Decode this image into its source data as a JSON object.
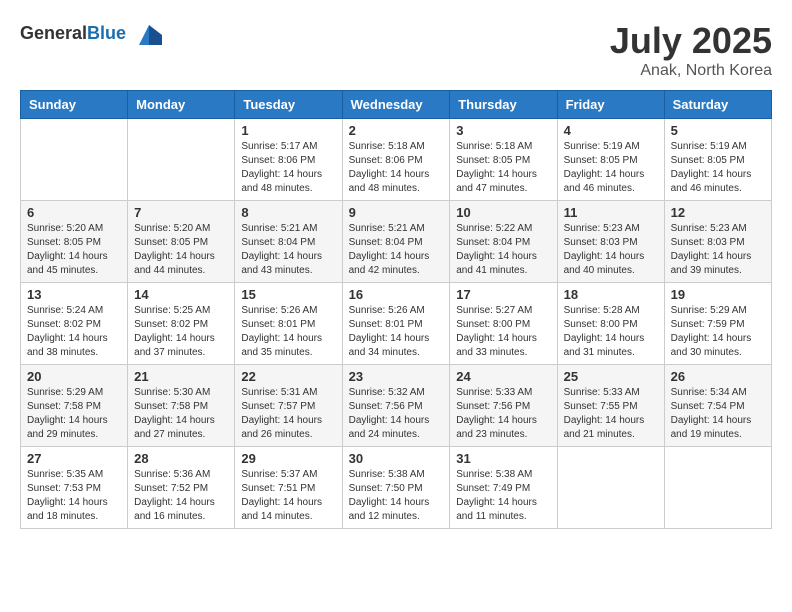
{
  "header": {
    "logo_general": "General",
    "logo_blue": "Blue",
    "month_year": "July 2025",
    "location": "Anak, North Korea"
  },
  "weekdays": [
    "Sunday",
    "Monday",
    "Tuesday",
    "Wednesday",
    "Thursday",
    "Friday",
    "Saturday"
  ],
  "weeks": [
    [
      {
        "day": "",
        "sunrise": "",
        "sunset": "",
        "daylight": ""
      },
      {
        "day": "",
        "sunrise": "",
        "sunset": "",
        "daylight": ""
      },
      {
        "day": "1",
        "sunrise": "Sunrise: 5:17 AM",
        "sunset": "Sunset: 8:06 PM",
        "daylight": "Daylight: 14 hours and 48 minutes."
      },
      {
        "day": "2",
        "sunrise": "Sunrise: 5:18 AM",
        "sunset": "Sunset: 8:06 PM",
        "daylight": "Daylight: 14 hours and 48 minutes."
      },
      {
        "day": "3",
        "sunrise": "Sunrise: 5:18 AM",
        "sunset": "Sunset: 8:05 PM",
        "daylight": "Daylight: 14 hours and 47 minutes."
      },
      {
        "day": "4",
        "sunrise": "Sunrise: 5:19 AM",
        "sunset": "Sunset: 8:05 PM",
        "daylight": "Daylight: 14 hours and 46 minutes."
      },
      {
        "day": "5",
        "sunrise": "Sunrise: 5:19 AM",
        "sunset": "Sunset: 8:05 PM",
        "daylight": "Daylight: 14 hours and 46 minutes."
      }
    ],
    [
      {
        "day": "6",
        "sunrise": "Sunrise: 5:20 AM",
        "sunset": "Sunset: 8:05 PM",
        "daylight": "Daylight: 14 hours and 45 minutes."
      },
      {
        "day": "7",
        "sunrise": "Sunrise: 5:20 AM",
        "sunset": "Sunset: 8:05 PM",
        "daylight": "Daylight: 14 hours and 44 minutes."
      },
      {
        "day": "8",
        "sunrise": "Sunrise: 5:21 AM",
        "sunset": "Sunset: 8:04 PM",
        "daylight": "Daylight: 14 hours and 43 minutes."
      },
      {
        "day": "9",
        "sunrise": "Sunrise: 5:21 AM",
        "sunset": "Sunset: 8:04 PM",
        "daylight": "Daylight: 14 hours and 42 minutes."
      },
      {
        "day": "10",
        "sunrise": "Sunrise: 5:22 AM",
        "sunset": "Sunset: 8:04 PM",
        "daylight": "Daylight: 14 hours and 41 minutes."
      },
      {
        "day": "11",
        "sunrise": "Sunrise: 5:23 AM",
        "sunset": "Sunset: 8:03 PM",
        "daylight": "Daylight: 14 hours and 40 minutes."
      },
      {
        "day": "12",
        "sunrise": "Sunrise: 5:23 AM",
        "sunset": "Sunset: 8:03 PM",
        "daylight": "Daylight: 14 hours and 39 minutes."
      }
    ],
    [
      {
        "day": "13",
        "sunrise": "Sunrise: 5:24 AM",
        "sunset": "Sunset: 8:02 PM",
        "daylight": "Daylight: 14 hours and 38 minutes."
      },
      {
        "day": "14",
        "sunrise": "Sunrise: 5:25 AM",
        "sunset": "Sunset: 8:02 PM",
        "daylight": "Daylight: 14 hours and 37 minutes."
      },
      {
        "day": "15",
        "sunrise": "Sunrise: 5:26 AM",
        "sunset": "Sunset: 8:01 PM",
        "daylight": "Daylight: 14 hours and 35 minutes."
      },
      {
        "day": "16",
        "sunrise": "Sunrise: 5:26 AM",
        "sunset": "Sunset: 8:01 PM",
        "daylight": "Daylight: 14 hours and 34 minutes."
      },
      {
        "day": "17",
        "sunrise": "Sunrise: 5:27 AM",
        "sunset": "Sunset: 8:00 PM",
        "daylight": "Daylight: 14 hours and 33 minutes."
      },
      {
        "day": "18",
        "sunrise": "Sunrise: 5:28 AM",
        "sunset": "Sunset: 8:00 PM",
        "daylight": "Daylight: 14 hours and 31 minutes."
      },
      {
        "day": "19",
        "sunrise": "Sunrise: 5:29 AM",
        "sunset": "Sunset: 7:59 PM",
        "daylight": "Daylight: 14 hours and 30 minutes."
      }
    ],
    [
      {
        "day": "20",
        "sunrise": "Sunrise: 5:29 AM",
        "sunset": "Sunset: 7:58 PM",
        "daylight": "Daylight: 14 hours and 29 minutes."
      },
      {
        "day": "21",
        "sunrise": "Sunrise: 5:30 AM",
        "sunset": "Sunset: 7:58 PM",
        "daylight": "Daylight: 14 hours and 27 minutes."
      },
      {
        "day": "22",
        "sunrise": "Sunrise: 5:31 AM",
        "sunset": "Sunset: 7:57 PM",
        "daylight": "Daylight: 14 hours and 26 minutes."
      },
      {
        "day": "23",
        "sunrise": "Sunrise: 5:32 AM",
        "sunset": "Sunset: 7:56 PM",
        "daylight": "Daylight: 14 hours and 24 minutes."
      },
      {
        "day": "24",
        "sunrise": "Sunrise: 5:33 AM",
        "sunset": "Sunset: 7:56 PM",
        "daylight": "Daylight: 14 hours and 23 minutes."
      },
      {
        "day": "25",
        "sunrise": "Sunrise: 5:33 AM",
        "sunset": "Sunset: 7:55 PM",
        "daylight": "Daylight: 14 hours and 21 minutes."
      },
      {
        "day": "26",
        "sunrise": "Sunrise: 5:34 AM",
        "sunset": "Sunset: 7:54 PM",
        "daylight": "Daylight: 14 hours and 19 minutes."
      }
    ],
    [
      {
        "day": "27",
        "sunrise": "Sunrise: 5:35 AM",
        "sunset": "Sunset: 7:53 PM",
        "daylight": "Daylight: 14 hours and 18 minutes."
      },
      {
        "day": "28",
        "sunrise": "Sunrise: 5:36 AM",
        "sunset": "Sunset: 7:52 PM",
        "daylight": "Daylight: 14 hours and 16 minutes."
      },
      {
        "day": "29",
        "sunrise": "Sunrise: 5:37 AM",
        "sunset": "Sunset: 7:51 PM",
        "daylight": "Daylight: 14 hours and 14 minutes."
      },
      {
        "day": "30",
        "sunrise": "Sunrise: 5:38 AM",
        "sunset": "Sunset: 7:50 PM",
        "daylight": "Daylight: 14 hours and 12 minutes."
      },
      {
        "day": "31",
        "sunrise": "Sunrise: 5:38 AM",
        "sunset": "Sunset: 7:49 PM",
        "daylight": "Daylight: 14 hours and 11 minutes."
      },
      {
        "day": "",
        "sunrise": "",
        "sunset": "",
        "daylight": ""
      },
      {
        "day": "",
        "sunrise": "",
        "sunset": "",
        "daylight": ""
      }
    ]
  ]
}
